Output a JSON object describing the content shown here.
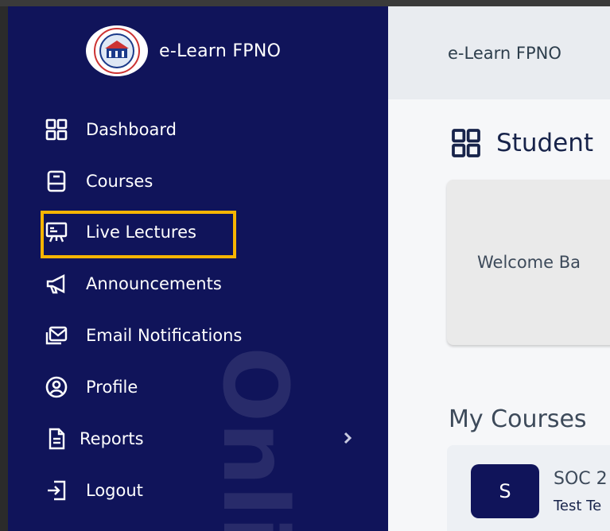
{
  "sidebar": {
    "brand": {
      "title": "e-Learn FPNO"
    },
    "watermark": "Onli",
    "items": [
      {
        "label": "Dashboard",
        "icon": "grid-icon"
      },
      {
        "label": "Courses",
        "icon": "book-icon"
      },
      {
        "label": "Live Lectures",
        "icon": "presentation-icon",
        "highlighted": true
      },
      {
        "label": "Announcements",
        "icon": "megaphone-icon"
      },
      {
        "label": "Email Notifications",
        "icon": "mail-icon"
      },
      {
        "label": "Profile",
        "icon": "user-circle-icon"
      },
      {
        "label": "Reports",
        "icon": "document-icon",
        "has_submenu": true
      },
      {
        "label": "Logout",
        "icon": "logout-icon"
      }
    ]
  },
  "header": {
    "title": "e-Learn FPNO"
  },
  "main": {
    "section_title": "Student",
    "welcome_text": "Welcome Ba",
    "my_courses_title": "My Courses",
    "course": {
      "avatar_letter": "S",
      "code": "SOC 2",
      "subtitle": "Test Te"
    }
  },
  "colors": {
    "sidebar_bg": "#10145a",
    "highlight": "#f7b500",
    "main_bg": "#f6f7f9",
    "topbar_bg": "#e9ecf0"
  }
}
